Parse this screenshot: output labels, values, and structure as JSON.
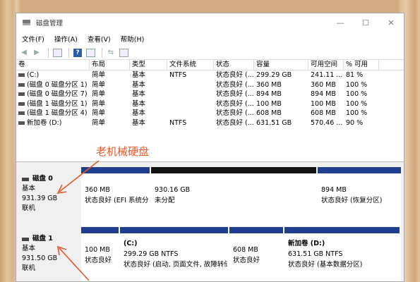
{
  "window": {
    "title": "磁盘管理",
    "controls": [
      "—",
      "☐",
      "✕"
    ]
  },
  "menu": [
    "文件(F)",
    "操作(A)",
    "查看(V)",
    "帮助(H)"
  ],
  "table": {
    "headers": [
      "卷",
      "布局",
      "类型",
      "文件系统",
      "状态",
      "容量",
      "可用空间",
      "% 可用"
    ],
    "rows": [
      [
        "(C:)",
        "简单",
        "基本",
        "NTFS",
        "状态良好 (...",
        "299.29 GB",
        "241.11 ...",
        "81 %"
      ],
      [
        "(磁盘 0 磁盘分区 1)",
        "简单",
        "基本",
        "",
        "状态良好 (...",
        "360 MB",
        "360 MB",
        "100 %"
      ],
      [
        "(磁盘 0 磁盘分区 7)",
        "简单",
        "基本",
        "",
        "状态良好 (...",
        "894 MB",
        "894 MB",
        "100 %"
      ],
      [
        "(磁盘 1 磁盘分区 1)",
        "简单",
        "基本",
        "",
        "状态良好 (...",
        "100 MB",
        "100 MB",
        "100 %"
      ],
      [
        "(磁盘 1 磁盘分区 4)",
        "简单",
        "基本",
        "",
        "状态良好 (...",
        "608 MB",
        "608 MB",
        "100 %"
      ],
      [
        "新加卷 (D:)",
        "简单",
        "基本",
        "NTFS",
        "状态良好 (...",
        "631.51 GB",
        "570.46 ...",
        "90 %"
      ]
    ]
  },
  "annotation": "老机械硬盘",
  "disks": [
    {
      "name": "磁盘 0",
      "type": "基本",
      "size": "931.39 GB",
      "status": "联机",
      "partitions": [
        {
          "title": "",
          "size": "360 MB",
          "status": "状态良好 (EFI 系统分区)",
          "bar": "blue"
        },
        {
          "title": "",
          "size": "930.16 GB",
          "status": "未分配",
          "bar": "black"
        },
        {
          "title": "",
          "size": "894 MB",
          "status": "状态良好 (恢复分区)",
          "bar": "blue"
        }
      ]
    },
    {
      "name": "磁盘 1",
      "type": "基本",
      "size": "931.50 GB",
      "status": "联机",
      "partitions": [
        {
          "title": "",
          "size": "100 MB",
          "status": "状态良好",
          "bar": "blue"
        },
        {
          "title": "(C:)",
          "size": "299.29 GB NTFS",
          "status": "状态良好 (启动, 页面文件, 故障转储",
          "bar": "blue"
        },
        {
          "title": "",
          "size": "608 MB",
          "status": "状态良好",
          "bar": "blue"
        },
        {
          "title": "新加卷  (D:)",
          "size": "631.51 GB NTFS",
          "status": "状态良好 (基本数据分区)",
          "bar": "blue"
        }
      ]
    }
  ],
  "colors": {
    "accent_blue": "#1f3f8e",
    "unallocated": "#111111",
    "annotation": "#e0582b"
  }
}
